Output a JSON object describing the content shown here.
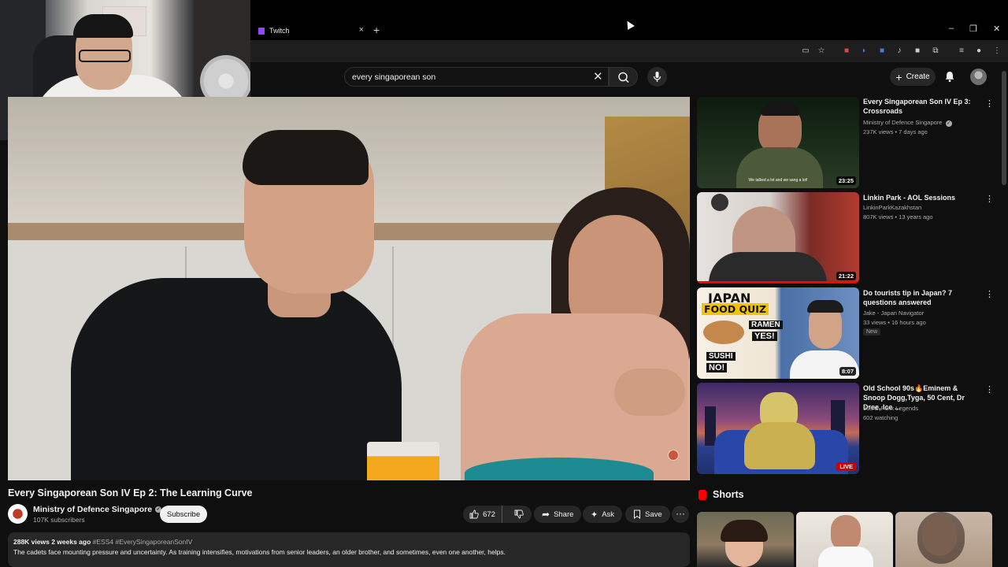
{
  "browser": {
    "tab_title": "Twitch",
    "tab_close": "×",
    "new_tab": "+",
    "minimize": "–",
    "restore": "❐",
    "close": "✕"
  },
  "search": {
    "query": "every singaporean son",
    "clear": "✕"
  },
  "header": {
    "create_label": "Create",
    "create_plus": "+"
  },
  "video": {
    "title": "Every Singaporean Son IV Ep 2: The Learning Curve",
    "channel": "Ministry of Defence Singapore",
    "subscribers": "107K subscribers",
    "subscribe_label": "Subscribe",
    "likes": "672",
    "share_label": "Share",
    "ask_label": "Ask",
    "save_label": "Save",
    "more": "···",
    "views_date": "288K views  2 weeks ago",
    "tags": "#ESS4 #EverySingaporeanSonIV",
    "description": "The cadets face mounting pressure and uncertainty. As training intensifies, motivations from senior leaders, an older brother, and sometimes, even one another, helps."
  },
  "recommendations": [
    {
      "title": "Every Singaporean Son IV Ep 3: Crossroads",
      "channel": "Ministry of Defence Singapore",
      "meta": "237K views • 7 days ago",
      "duration": "23:25",
      "caption": "We talked a lot and we sang a lot!"
    },
    {
      "title": "Linkin Park - AOL Sessions",
      "channel": "LinkinParkKazakhstan",
      "meta": "807K views • 13 years ago",
      "duration": "21:22"
    },
    {
      "title": "Do tourists tip in Japan? 7 questions answered",
      "channel": "Jake - Japan Navigator",
      "meta": "33 views • 16 hours ago",
      "badge": "New",
      "duration": "8:07",
      "thumb_text": [
        "JAPAN",
        "FOOD QUIZ",
        "RAMEN",
        "YES!",
        "SUSHI",
        "NO!"
      ]
    },
    {
      "title": "Old School 90s🔥Eminem & Snoop Dogg,Tyga, 50 Cent, Dr Dree, Ice ...",
      "channel": "90s G-Funk Legends",
      "meta": "602 watching",
      "live": "LIVE"
    }
  ],
  "shorts": {
    "title": "Shorts"
  },
  "colors": {
    "background": "#0f0f0f",
    "accent_red": "#ff0000",
    "twitch_purple": "#9146ff"
  }
}
